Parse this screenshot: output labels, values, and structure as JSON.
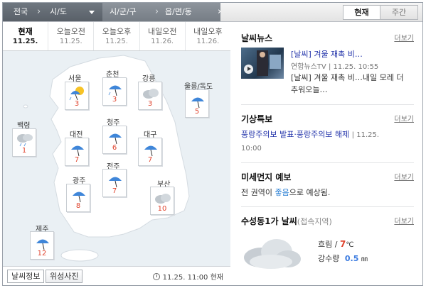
{
  "topbar": {
    "loc1": "전국",
    "loc2": "시/도",
    "loc3": "시/군/구",
    "loc4": "읍/면/동",
    "tab_now": "현재",
    "tab_week": "주간"
  },
  "timebar": [
    {
      "label": "현재",
      "date": "11.25."
    },
    {
      "label": "오늘오전",
      "date": "11.25."
    },
    {
      "label": "오늘오후",
      "date": "11.25."
    },
    {
      "label": "내일오전",
      "date": "11.26."
    },
    {
      "label": "내일오후",
      "date": "11.26."
    }
  ],
  "cities": [
    {
      "name": "서울",
      "temp": "3",
      "icon": "rain-sun-umbrella-icon"
    },
    {
      "name": "춘천",
      "temp": "3",
      "icon": "umbrella-icon"
    },
    {
      "name": "강릉",
      "temp": "3",
      "icon": "cloud-icon"
    },
    {
      "name": "울릉/독도",
      "temp": "5",
      "icon": "umbrella-icon"
    },
    {
      "name": "백령",
      "temp": "1",
      "icon": "rain-cloud-icon"
    },
    {
      "name": "대전",
      "temp": "7",
      "icon": "umbrella-icon"
    },
    {
      "name": "청주",
      "temp": "6",
      "icon": "umbrella-icon"
    },
    {
      "name": "대구",
      "temp": "7",
      "icon": "umbrella-icon"
    },
    {
      "name": "전주",
      "temp": "7",
      "icon": "umbrella-icon"
    },
    {
      "name": "광주",
      "temp": "8",
      "icon": "umbrella-icon"
    },
    {
      "name": "부산",
      "temp": "10",
      "icon": "cloud-icon"
    },
    {
      "name": "제주",
      "temp": "12",
      "icon": "umbrella-icon"
    }
  ],
  "footer": {
    "btn1": "날씨정보",
    "btn2": "위성사진",
    "time": "11.25. 11:00 현재"
  },
  "news": {
    "title": "날씨뉴스",
    "more": "더보기",
    "headline_tag": "[날씨]",
    "headline": " 겨울 재촉 비…",
    "source": "연합뉴스TV",
    "time": "| 11.25. 10:55",
    "snippet": "[날씨] 겨울 재촉 비…내일 모레 더 추워오늘…"
  },
  "warning": {
    "title": "기상특보",
    "more": "더보기",
    "link": "풍랑주의보 발표·풍랑주의보 해제",
    "time_a": "| 11.25.",
    "time_b": "10:00"
  },
  "dust": {
    "title": "미세먼지 예보",
    "more": "더보기",
    "prefix": "전 권역이 ",
    "level": "좋음",
    "suffix": "으로 예상됨."
  },
  "local": {
    "title": "수성동1가 날씨",
    "subtitle": "(접속지역)",
    "more": "더보기",
    "cond": "흐림 /",
    "temp": "7",
    "unit": "℃",
    "precip_label": "강수량",
    "precip_value": "0.5",
    "precip_unit": "㎜"
  },
  "colors": {
    "accent_blue": "#2233aa",
    "temp_red": "#e0432d",
    "precip_blue": "#3b7be0"
  }
}
